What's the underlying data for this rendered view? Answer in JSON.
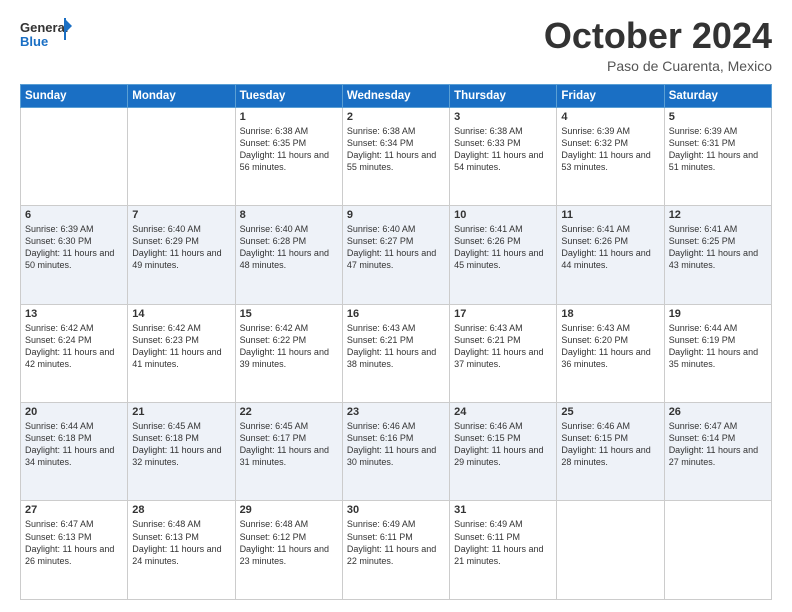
{
  "header": {
    "logo_general": "General",
    "logo_blue": "Blue",
    "month_title": "October 2024",
    "location": "Paso de Cuarenta, Mexico"
  },
  "days_of_week": [
    "Sunday",
    "Monday",
    "Tuesday",
    "Wednesday",
    "Thursday",
    "Friday",
    "Saturday"
  ],
  "weeks": [
    [
      {
        "day": "",
        "sunrise": "",
        "sunset": "",
        "daylight": ""
      },
      {
        "day": "",
        "sunrise": "",
        "sunset": "",
        "daylight": ""
      },
      {
        "day": "1",
        "sunrise": "Sunrise: 6:38 AM",
        "sunset": "Sunset: 6:35 PM",
        "daylight": "Daylight: 11 hours and 56 minutes."
      },
      {
        "day": "2",
        "sunrise": "Sunrise: 6:38 AM",
        "sunset": "Sunset: 6:34 PM",
        "daylight": "Daylight: 11 hours and 55 minutes."
      },
      {
        "day": "3",
        "sunrise": "Sunrise: 6:38 AM",
        "sunset": "Sunset: 6:33 PM",
        "daylight": "Daylight: 11 hours and 54 minutes."
      },
      {
        "day": "4",
        "sunrise": "Sunrise: 6:39 AM",
        "sunset": "Sunset: 6:32 PM",
        "daylight": "Daylight: 11 hours and 53 minutes."
      },
      {
        "day": "5",
        "sunrise": "Sunrise: 6:39 AM",
        "sunset": "Sunset: 6:31 PM",
        "daylight": "Daylight: 11 hours and 51 minutes."
      }
    ],
    [
      {
        "day": "6",
        "sunrise": "Sunrise: 6:39 AM",
        "sunset": "Sunset: 6:30 PM",
        "daylight": "Daylight: 11 hours and 50 minutes."
      },
      {
        "day": "7",
        "sunrise": "Sunrise: 6:40 AM",
        "sunset": "Sunset: 6:29 PM",
        "daylight": "Daylight: 11 hours and 49 minutes."
      },
      {
        "day": "8",
        "sunrise": "Sunrise: 6:40 AM",
        "sunset": "Sunset: 6:28 PM",
        "daylight": "Daylight: 11 hours and 48 minutes."
      },
      {
        "day": "9",
        "sunrise": "Sunrise: 6:40 AM",
        "sunset": "Sunset: 6:27 PM",
        "daylight": "Daylight: 11 hours and 47 minutes."
      },
      {
        "day": "10",
        "sunrise": "Sunrise: 6:41 AM",
        "sunset": "Sunset: 6:26 PM",
        "daylight": "Daylight: 11 hours and 45 minutes."
      },
      {
        "day": "11",
        "sunrise": "Sunrise: 6:41 AM",
        "sunset": "Sunset: 6:26 PM",
        "daylight": "Daylight: 11 hours and 44 minutes."
      },
      {
        "day": "12",
        "sunrise": "Sunrise: 6:41 AM",
        "sunset": "Sunset: 6:25 PM",
        "daylight": "Daylight: 11 hours and 43 minutes."
      }
    ],
    [
      {
        "day": "13",
        "sunrise": "Sunrise: 6:42 AM",
        "sunset": "Sunset: 6:24 PM",
        "daylight": "Daylight: 11 hours and 42 minutes."
      },
      {
        "day": "14",
        "sunrise": "Sunrise: 6:42 AM",
        "sunset": "Sunset: 6:23 PM",
        "daylight": "Daylight: 11 hours and 41 minutes."
      },
      {
        "day": "15",
        "sunrise": "Sunrise: 6:42 AM",
        "sunset": "Sunset: 6:22 PM",
        "daylight": "Daylight: 11 hours and 39 minutes."
      },
      {
        "day": "16",
        "sunrise": "Sunrise: 6:43 AM",
        "sunset": "Sunset: 6:21 PM",
        "daylight": "Daylight: 11 hours and 38 minutes."
      },
      {
        "day": "17",
        "sunrise": "Sunrise: 6:43 AM",
        "sunset": "Sunset: 6:21 PM",
        "daylight": "Daylight: 11 hours and 37 minutes."
      },
      {
        "day": "18",
        "sunrise": "Sunrise: 6:43 AM",
        "sunset": "Sunset: 6:20 PM",
        "daylight": "Daylight: 11 hours and 36 minutes."
      },
      {
        "day": "19",
        "sunrise": "Sunrise: 6:44 AM",
        "sunset": "Sunset: 6:19 PM",
        "daylight": "Daylight: 11 hours and 35 minutes."
      }
    ],
    [
      {
        "day": "20",
        "sunrise": "Sunrise: 6:44 AM",
        "sunset": "Sunset: 6:18 PM",
        "daylight": "Daylight: 11 hours and 34 minutes."
      },
      {
        "day": "21",
        "sunrise": "Sunrise: 6:45 AM",
        "sunset": "Sunset: 6:18 PM",
        "daylight": "Daylight: 11 hours and 32 minutes."
      },
      {
        "day": "22",
        "sunrise": "Sunrise: 6:45 AM",
        "sunset": "Sunset: 6:17 PM",
        "daylight": "Daylight: 11 hours and 31 minutes."
      },
      {
        "day": "23",
        "sunrise": "Sunrise: 6:46 AM",
        "sunset": "Sunset: 6:16 PM",
        "daylight": "Daylight: 11 hours and 30 minutes."
      },
      {
        "day": "24",
        "sunrise": "Sunrise: 6:46 AM",
        "sunset": "Sunset: 6:15 PM",
        "daylight": "Daylight: 11 hours and 29 minutes."
      },
      {
        "day": "25",
        "sunrise": "Sunrise: 6:46 AM",
        "sunset": "Sunset: 6:15 PM",
        "daylight": "Daylight: 11 hours and 28 minutes."
      },
      {
        "day": "26",
        "sunrise": "Sunrise: 6:47 AM",
        "sunset": "Sunset: 6:14 PM",
        "daylight": "Daylight: 11 hours and 27 minutes."
      }
    ],
    [
      {
        "day": "27",
        "sunrise": "Sunrise: 6:47 AM",
        "sunset": "Sunset: 6:13 PM",
        "daylight": "Daylight: 11 hours and 26 minutes."
      },
      {
        "day": "28",
        "sunrise": "Sunrise: 6:48 AM",
        "sunset": "Sunset: 6:13 PM",
        "daylight": "Daylight: 11 hours and 24 minutes."
      },
      {
        "day": "29",
        "sunrise": "Sunrise: 6:48 AM",
        "sunset": "Sunset: 6:12 PM",
        "daylight": "Daylight: 11 hours and 23 minutes."
      },
      {
        "day": "30",
        "sunrise": "Sunrise: 6:49 AM",
        "sunset": "Sunset: 6:11 PM",
        "daylight": "Daylight: 11 hours and 22 minutes."
      },
      {
        "day": "31",
        "sunrise": "Sunrise: 6:49 AM",
        "sunset": "Sunset: 6:11 PM",
        "daylight": "Daylight: 11 hours and 21 minutes."
      },
      {
        "day": "",
        "sunrise": "",
        "sunset": "",
        "daylight": ""
      },
      {
        "day": "",
        "sunrise": "",
        "sunset": "",
        "daylight": ""
      }
    ]
  ]
}
